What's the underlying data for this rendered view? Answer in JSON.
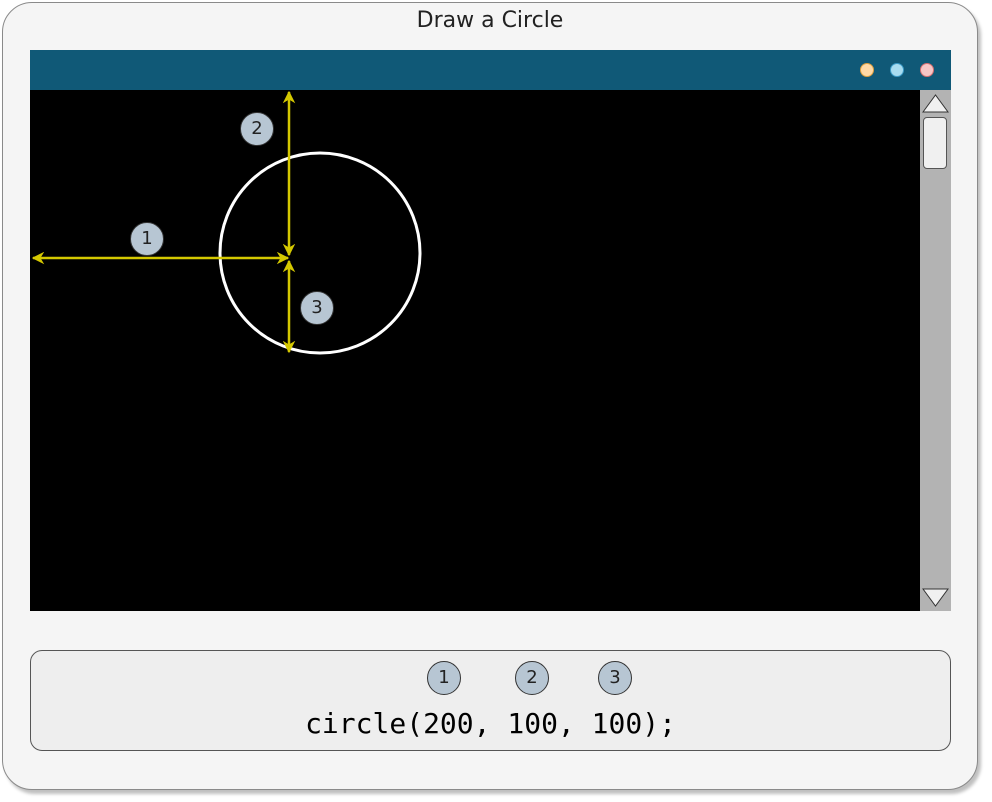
{
  "title": "Draw a Circle",
  "window": {
    "titlebar_color": "#105977",
    "canvas_color": "#000000",
    "buttons": [
      "minimize",
      "maximize",
      "close"
    ],
    "circle_color": "#ffffff",
    "arrow_color": "#d4c800"
  },
  "annotations": [
    "1",
    "2",
    "3"
  ],
  "code": {
    "badges": [
      "1",
      "2",
      "3"
    ],
    "text": "circle(200, 100, 100);"
  }
}
